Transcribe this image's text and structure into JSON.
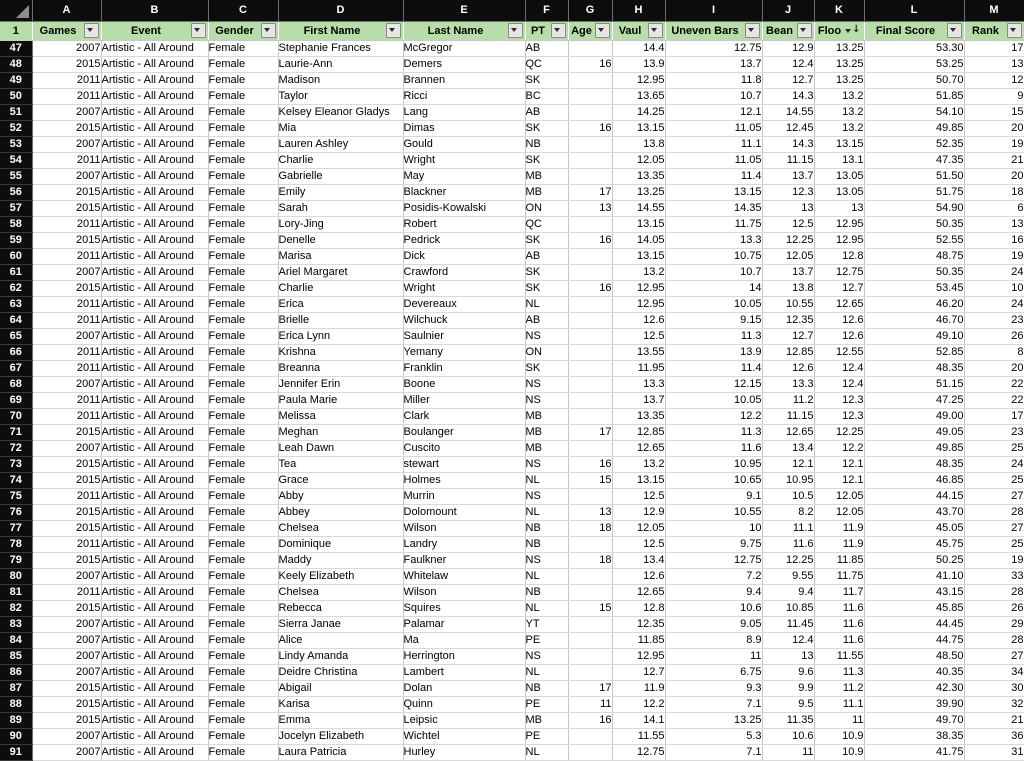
{
  "spreadsheet": {
    "corner_icon": "select-all-triangle-icon",
    "column_letters": [
      "A",
      "B",
      "C",
      "D",
      "E",
      "F",
      "G",
      "H",
      "I",
      "J",
      "K",
      "L",
      "M"
    ],
    "header_row_number": "1",
    "filter_header": {
      "row_label": "1",
      "columns": [
        {
          "label": "Games",
          "filter": true,
          "sorted": false,
          "align": "center"
        },
        {
          "label": "Event",
          "filter": true,
          "sorted": false,
          "align": "center"
        },
        {
          "label": "Gender",
          "filter": true,
          "sorted": false,
          "align": "center"
        },
        {
          "label": "First Name",
          "filter": true,
          "sorted": false,
          "align": "center"
        },
        {
          "label": "Last Name",
          "filter": true,
          "sorted": false,
          "align": "center"
        },
        {
          "label": "PT",
          "filter": true,
          "sorted": false,
          "align": "center"
        },
        {
          "label": "Age",
          "filter": true,
          "sorted": false,
          "align": "center"
        },
        {
          "label": "Vaul",
          "filter": true,
          "sorted": false,
          "align": "center"
        },
        {
          "label": "Uneven Bars",
          "filter": true,
          "sorted": false,
          "align": "center"
        },
        {
          "label": "Bean",
          "filter": true,
          "sorted": false,
          "align": "center"
        },
        {
          "label": "Floo",
          "filter": true,
          "sorted": true,
          "align": "center"
        },
        {
          "label": "Final Score",
          "filter": true,
          "sorted": false,
          "align": "center"
        },
        {
          "label": "Rank",
          "filter": true,
          "sorted": false,
          "align": "center"
        }
      ]
    },
    "colors": {
      "header_green": "#b7dda8",
      "gutter_dark": "#0d0d0d",
      "gridline": "#c6c6c6",
      "cell_background": "#ffffff",
      "text": "#000000"
    }
  },
  "chart_data": {
    "type": "table",
    "title": "Artistic - All Around gymnastics results",
    "columns": [
      "Games",
      "Event",
      "Gender",
      "First Name",
      "Last Name",
      "PT",
      "Age",
      "Vaul",
      "Uneven Bars",
      "Bean",
      "Floo",
      "Final Score",
      "Rank"
    ],
    "row_numbers": [
      47,
      48,
      49,
      50,
      51,
      52,
      53,
      54,
      55,
      56,
      57,
      58,
      59,
      60,
      61,
      62,
      63,
      64,
      65,
      66,
      67,
      68,
      69,
      70,
      71,
      72,
      73,
      74,
      75,
      76,
      77,
      78,
      79,
      80,
      81,
      82,
      83,
      84,
      85,
      86,
      87,
      88,
      89,
      90,
      91
    ],
    "rows": [
      [
        "2007",
        "Artistic - All Around",
        "Female",
        "Stephanie Frances",
        "McGregor",
        "AB",
        "",
        "14.4",
        "12.75",
        "12.9",
        "13.25",
        "53.30",
        "17"
      ],
      [
        "2015",
        "Artistic - All Around",
        "Female",
        "Laurie-Ann",
        "Demers",
        "QC",
        "16",
        "13.9",
        "13.7",
        "12.4",
        "13.25",
        "53.25",
        "13"
      ],
      [
        "2011",
        "Artistic - All Around",
        "Female",
        "Madison",
        "Brannen",
        "SK",
        "",
        "12.95",
        "11.8",
        "12.7",
        "13.25",
        "50.70",
        "12"
      ],
      [
        "2011",
        "Artistic - All Around",
        "Female",
        "Taylor",
        "Ricci",
        "BC",
        "",
        "13.65",
        "10.7",
        "14.3",
        "13.2",
        "51.85",
        "9"
      ],
      [
        "2007",
        "Artistic - All Around",
        "Female",
        "Kelsey Eleanor Gladys",
        "Lang",
        "AB",
        "",
        "14.25",
        "12.1",
        "14.55",
        "13.2",
        "54.10",
        "15"
      ],
      [
        "2015",
        "Artistic - All Around",
        "Female",
        "Mia",
        "Dimas",
        "SK",
        "16",
        "13.15",
        "11.05",
        "12.45",
        "13.2",
        "49.85",
        "20"
      ],
      [
        "2007",
        "Artistic - All Around",
        "Female",
        "Lauren Ashley",
        "Gould",
        "NB",
        "",
        "13.8",
        "11.1",
        "14.3",
        "13.15",
        "52.35",
        "19"
      ],
      [
        "2011",
        "Artistic - All Around",
        "Female",
        "Charlie",
        "Wright",
        "SK",
        "",
        "12.05",
        "11.05",
        "11.15",
        "13.1",
        "47.35",
        "21"
      ],
      [
        "2007",
        "Artistic - All Around",
        "Female",
        "Gabrielle",
        "May",
        "MB",
        "",
        "13.35",
        "11.4",
        "13.7",
        "13.05",
        "51.50",
        "20"
      ],
      [
        "2015",
        "Artistic - All Around",
        "Female",
        "Emily",
        "Blackner",
        "MB",
        "17",
        "13.25",
        "13.15",
        "12.3",
        "13.05",
        "51.75",
        "18"
      ],
      [
        "2015",
        "Artistic - All Around",
        "Female",
        "Sarah",
        "Posidis-Kowalski",
        "ON",
        "13",
        "14.55",
        "14.35",
        "13",
        "13",
        "54.90",
        "6"
      ],
      [
        "2011",
        "Artistic - All Around",
        "Female",
        "Lory-Jing",
        "Robert",
        "QC",
        "",
        "13.15",
        "11.75",
        "12.5",
        "12.95",
        "50.35",
        "13"
      ],
      [
        "2015",
        "Artistic - All Around",
        "Female",
        "Denelle",
        "Pedrick",
        "SK",
        "16",
        "14.05",
        "13.3",
        "12.25",
        "12.95",
        "52.55",
        "16"
      ],
      [
        "2011",
        "Artistic - All Around",
        "Female",
        "Marisa",
        "Dick",
        "AB",
        "",
        "13.15",
        "10.75",
        "12.05",
        "12.8",
        "48.75",
        "19"
      ],
      [
        "2007",
        "Artistic - All Around",
        "Female",
        "Ariel Margaret",
        "Crawford",
        "SK",
        "",
        "13.2",
        "10.7",
        "13.7",
        "12.75",
        "50.35",
        "24"
      ],
      [
        "2015",
        "Artistic - All Around",
        "Female",
        "Charlie",
        "Wright",
        "SK",
        "16",
        "12.95",
        "14",
        "13.8",
        "12.7",
        "53.45",
        "10"
      ],
      [
        "2011",
        "Artistic - All Around",
        "Female",
        "Erica",
        "Devereaux",
        "NL",
        "",
        "12.95",
        "10.05",
        "10.55",
        "12.65",
        "46.20",
        "24"
      ],
      [
        "2011",
        "Artistic - All Around",
        "Female",
        "Brielle",
        "Wilchuck",
        "AB",
        "",
        "12.6",
        "9.15",
        "12.35",
        "12.6",
        "46.70",
        "23"
      ],
      [
        "2007",
        "Artistic - All Around",
        "Female",
        "Erica Lynn",
        "Saulnier",
        "NS",
        "",
        "12.5",
        "11.3",
        "12.7",
        "12.6",
        "49.10",
        "26"
      ],
      [
        "2011",
        "Artistic - All Around",
        "Female",
        "Krishna",
        "Yemany",
        "ON",
        "",
        "13.55",
        "13.9",
        "12.85",
        "12.55",
        "52.85",
        "8"
      ],
      [
        "2011",
        "Artistic - All Around",
        "Female",
        "Breanna",
        "Franklin",
        "SK",
        "",
        "11.95",
        "11.4",
        "12.6",
        "12.4",
        "48.35",
        "20"
      ],
      [
        "2007",
        "Artistic - All Around",
        "Female",
        "Jennifer Erin",
        "Boone",
        "NS",
        "",
        "13.3",
        "12.15",
        "13.3",
        "12.4",
        "51.15",
        "22"
      ],
      [
        "2011",
        "Artistic - All Around",
        "Female",
        "Paula Marie",
        "Miller",
        "NS",
        "",
        "13.7",
        "10.05",
        "11.2",
        "12.3",
        "47.25",
        "22"
      ],
      [
        "2011",
        "Artistic - All Around",
        "Female",
        "Melissa",
        "Clark",
        "MB",
        "",
        "13.35",
        "12.2",
        "11.15",
        "12.3",
        "49.00",
        "17"
      ],
      [
        "2015",
        "Artistic - All Around",
        "Female",
        "Meghan",
        "Boulanger",
        "MB",
        "17",
        "12.85",
        "11.3",
        "12.65",
        "12.25",
        "49.05",
        "23"
      ],
      [
        "2007",
        "Artistic - All Around",
        "Female",
        "Leah Dawn",
        "Cuscito",
        "MB",
        "",
        "12.65",
        "11.6",
        "13.4",
        "12.2",
        "49.85",
        "25"
      ],
      [
        "2015",
        "Artistic - All Around",
        "Female",
        "Tea",
        "stewart",
        "NS",
        "16",
        "13.2",
        "10.95",
        "12.1",
        "12.1",
        "48.35",
        "24"
      ],
      [
        "2015",
        "Artistic - All Around",
        "Female",
        "Grace",
        "Holmes",
        "NL",
        "15",
        "13.15",
        "10.65",
        "10.95",
        "12.1",
        "46.85",
        "25"
      ],
      [
        "2011",
        "Artistic - All Around",
        "Female",
        "Abby",
        "Murrin",
        "NS",
        "",
        "12.5",
        "9.1",
        "10.5",
        "12.05",
        "44.15",
        "27"
      ],
      [
        "2015",
        "Artistic - All Around",
        "Female",
        "Abbey",
        "Dolomount",
        "NL",
        "13",
        "12.9",
        "10.55",
        "8.2",
        "12.05",
        "43.70",
        "28"
      ],
      [
        "2015",
        "Artistic - All Around",
        "Female",
        "Chelsea",
        "Wilson",
        "NB",
        "18",
        "12.05",
        "10",
        "11.1",
        "11.9",
        "45.05",
        "27"
      ],
      [
        "2011",
        "Artistic - All Around",
        "Female",
        "Dominique",
        "Landry",
        "NB",
        "",
        "12.5",
        "9.75",
        "11.6",
        "11.9",
        "45.75",
        "25"
      ],
      [
        "2015",
        "Artistic - All Around",
        "Female",
        "Maddy",
        "Faulkner",
        "NS",
        "18",
        "13.4",
        "12.75",
        "12.25",
        "11.85",
        "50.25",
        "19"
      ],
      [
        "2007",
        "Artistic - All Around",
        "Female",
        "Keely Elizabeth",
        "Whitelaw",
        "NL",
        "",
        "12.6",
        "7.2",
        "9.55",
        "11.75",
        "41.10",
        "33"
      ],
      [
        "2011",
        "Artistic - All Around",
        "Female",
        "Chelsea",
        "Wilson",
        "NB",
        "",
        "12.65",
        "9.4",
        "9.4",
        "11.7",
        "43.15",
        "28"
      ],
      [
        "2015",
        "Artistic - All Around",
        "Female",
        "Rebecca",
        "Squires",
        "NL",
        "15",
        "12.8",
        "10.6",
        "10.85",
        "11.6",
        "45.85",
        "26"
      ],
      [
        "2007",
        "Artistic - All Around",
        "Female",
        "Sierra Janae",
        "Palamar",
        "YT",
        "",
        "12.35",
        "9.05",
        "11.45",
        "11.6",
        "44.45",
        "29"
      ],
      [
        "2007",
        "Artistic - All Around",
        "Female",
        "Alice",
        "Ma",
        "PE",
        "",
        "11.85",
        "8.9",
        "12.4",
        "11.6",
        "44.75",
        "28"
      ],
      [
        "2007",
        "Artistic - All Around",
        "Female",
        "Lindy Amanda",
        "Herrington",
        "NS",
        "",
        "12.95",
        "11",
        "13",
        "11.55",
        "48.50",
        "27"
      ],
      [
        "2007",
        "Artistic - All Around",
        "Female",
        "Deidre Christina",
        "Lambert",
        "NL",
        "",
        "12.7",
        "6.75",
        "9.6",
        "11.3",
        "40.35",
        "34"
      ],
      [
        "2015",
        "Artistic - All Around",
        "Female",
        "Abigail",
        "Dolan",
        "NB",
        "17",
        "11.9",
        "9.3",
        "9.9",
        "11.2",
        "42.30",
        "30"
      ],
      [
        "2015",
        "Artistic - All Around",
        "Female",
        "Karisa",
        "Quinn",
        "PE",
        "11",
        "12.2",
        "7.1",
        "9.5",
        "11.1",
        "39.90",
        "32"
      ],
      [
        "2015",
        "Artistic - All Around",
        "Female",
        "Emma",
        "Leipsic",
        "MB",
        "16",
        "14.1",
        "13.25",
        "11.35",
        "11",
        "49.70",
        "21"
      ],
      [
        "2007",
        "Artistic - All Around",
        "Female",
        "Jocelyn Elizabeth",
        "Wichtel",
        "PE",
        "",
        "11.55",
        "5.3",
        "10.6",
        "10.9",
        "38.35",
        "36"
      ],
      [
        "2007",
        "Artistic - All Around",
        "Female",
        "Laura Patricia",
        "Hurley",
        "NL",
        "",
        "12.75",
        "7.1",
        "11",
        "10.9",
        "41.75",
        "31"
      ]
    ],
    "column_alignment": [
      "right",
      "left",
      "left",
      "left",
      "left",
      "left",
      "right",
      "right",
      "right",
      "right",
      "right",
      "right",
      "right"
    ]
  }
}
